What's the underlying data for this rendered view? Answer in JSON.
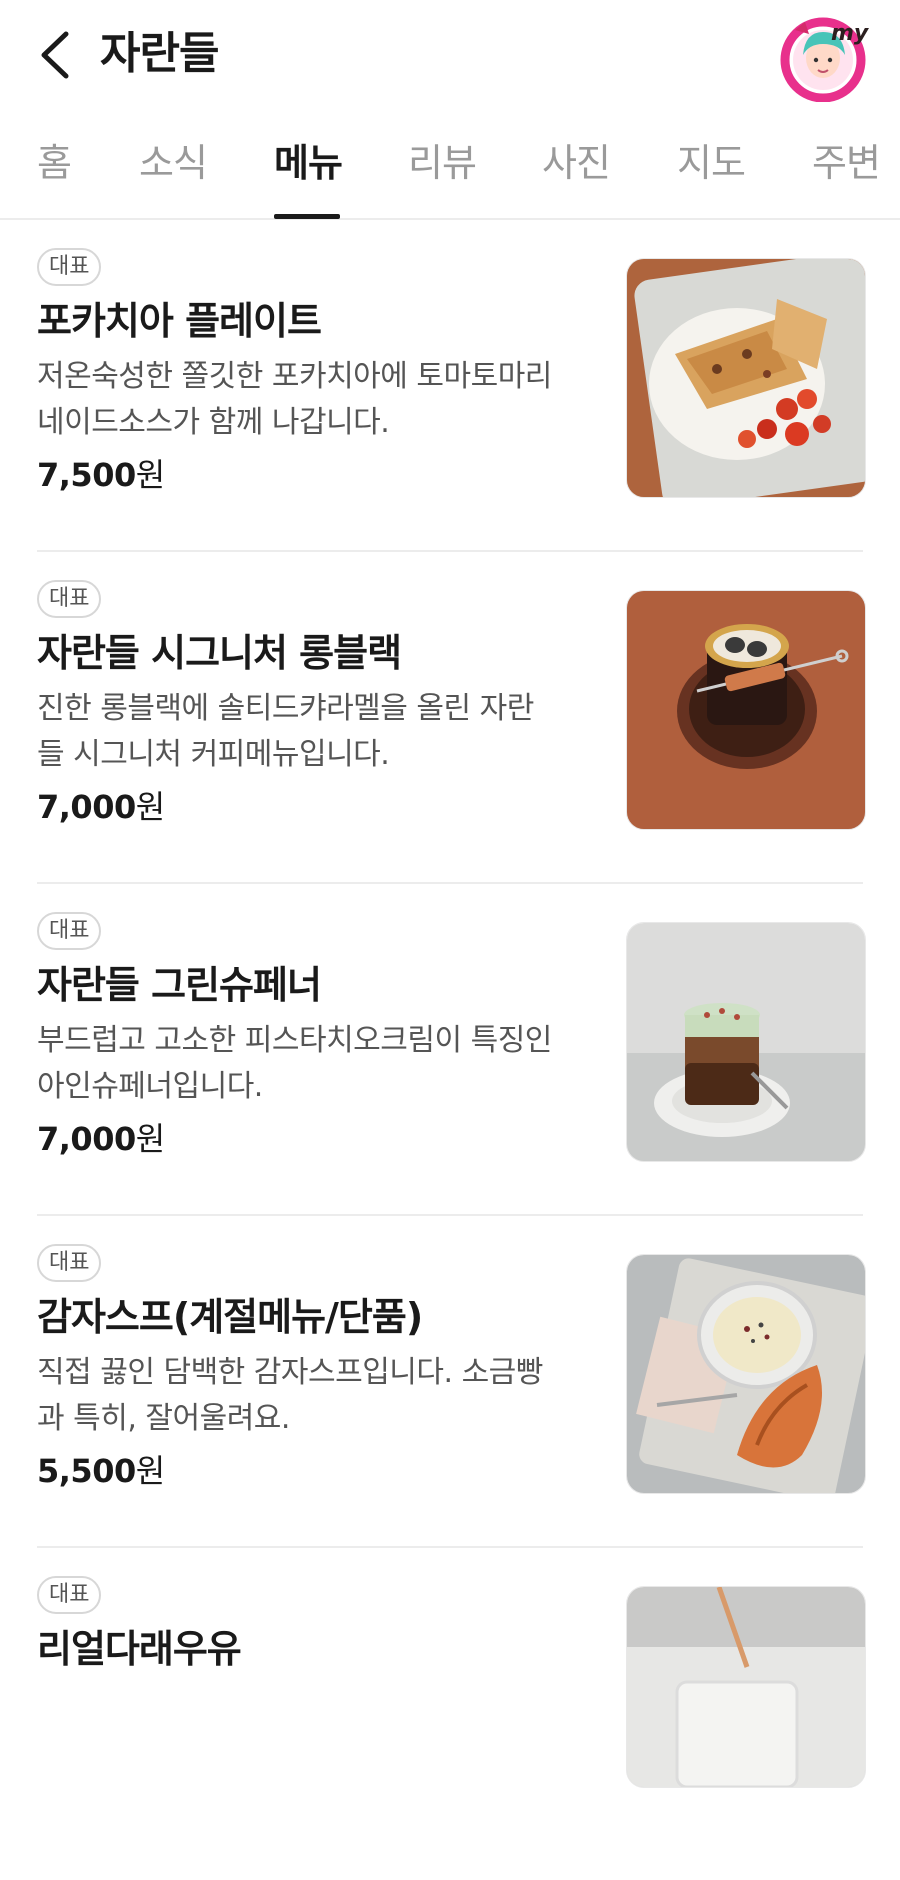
{
  "header": {
    "title": "자란들",
    "back_icon": "chevron-left-icon",
    "avatar_label": "my"
  },
  "tabs": [
    {
      "label": "홈",
      "active": false
    },
    {
      "label": "소식",
      "active": false
    },
    {
      "label": "메뉴",
      "active": true
    },
    {
      "label": "리뷰",
      "active": false
    },
    {
      "label": "사진",
      "active": false
    },
    {
      "label": "지도",
      "active": false
    },
    {
      "label": "주변",
      "active": false
    }
  ],
  "menu": {
    "items": [
      {
        "badge": "대표",
        "name": "포카치아 플레이트",
        "desc1": "저온숙성한 쫄깃한 포카치아에 토마토마리",
        "desc2": "네이드소스가 함께 나갑니다.",
        "price_num": "7,500",
        "price_unit": "원",
        "photo": "focaccia-plate-photo"
      },
      {
        "badge": "대표",
        "name": "자란들 시그니처 롱블랙",
        "desc1": "진한 롱블랙에 솔티드캬라멜을 올린 자란",
        "desc2": "들 시그니처 커피메뉴입니다.",
        "price_num": "7,000",
        "price_unit": "원",
        "photo": "long-black-photo"
      },
      {
        "badge": "대표",
        "name": "자란들 그린슈페너",
        "desc1": "부드럽고 고소한 피스타치오크림이 특징인",
        "desc2": "아인슈페너입니다.",
        "price_num": "7,000",
        "price_unit": "원",
        "photo": "green-einspanner-photo"
      },
      {
        "badge": "대표",
        "name": "감자스프(계절메뉴/단품)",
        "desc1": "직접 끓인 담백한 감자스프입니다. 소금빵",
        "desc2": "과 특히, 잘어울려요.",
        "price_num": "5,500",
        "price_unit": "원",
        "photo": "potato-soup-photo"
      },
      {
        "badge": "대표",
        "name": "리얼다래우유",
        "desc1": "",
        "desc2": "",
        "price_num": "",
        "price_unit": "",
        "photo": "kiwi-milk-photo"
      }
    ]
  }
}
